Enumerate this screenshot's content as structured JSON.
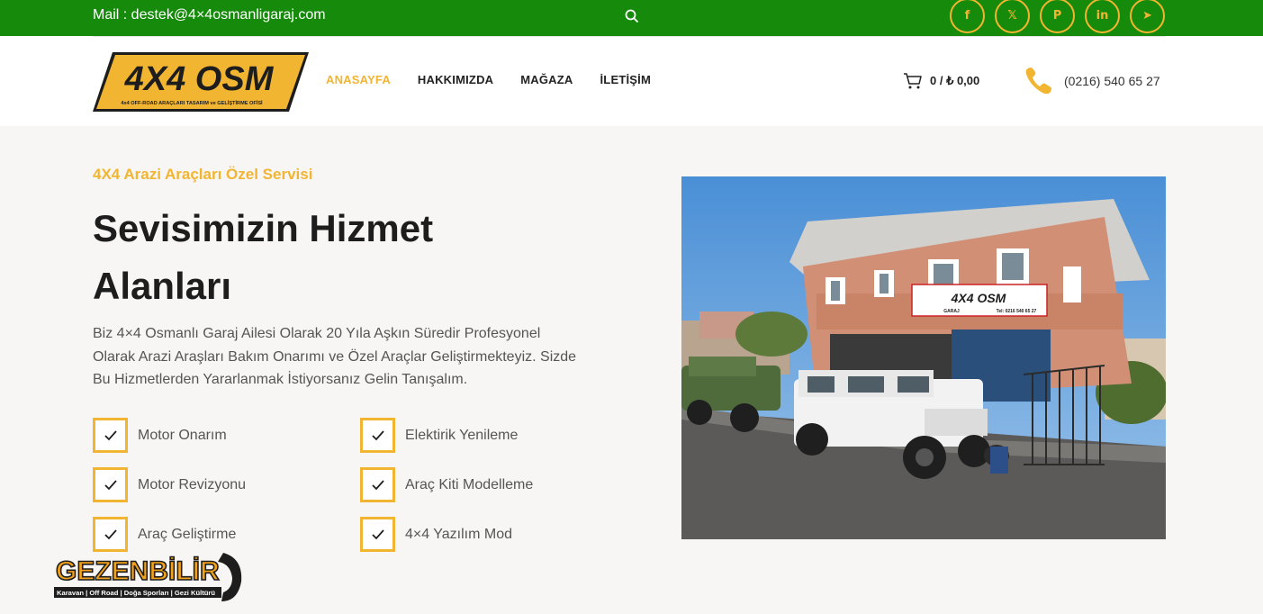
{
  "topbar": {
    "mail": "Mail : destek@4×4osmanligaraj.com",
    "socials": [
      {
        "icon": "facebook-icon",
        "glyph": "f"
      },
      {
        "icon": "x-twitter-icon",
        "glyph": "𝕏"
      },
      {
        "icon": "pinterest-icon",
        "glyph": "P"
      },
      {
        "icon": "linkedin-icon",
        "glyph": "in"
      },
      {
        "icon": "telegram-icon",
        "glyph": "➤"
      }
    ]
  },
  "logo": {
    "main": "4X4 OSM",
    "tagline": "4x4 OFF-ROAD ARAÇLARI TASARIM ve GELİŞTİRME OFİSİ"
  },
  "nav": [
    "ANASAYFA",
    "HAKKIMIZDA",
    "MAĞAZA",
    "İLETİŞİM"
  ],
  "cart": {
    "text": "0 / ₺ 0,00"
  },
  "phone": {
    "text": "(0216) 540 65 27"
  },
  "hero": {
    "subtitle": "4X4 Arazi Araçları Özel Servisi",
    "title_line1": "Sevisimizin Hizmet",
    "title_line2": "Alanları",
    "description": "Biz 4×4 Osmanlı Garaj Ailesi Olarak 20 Yıla Aşkın Süredir Profesyonel Olarak Arazi Araşları Bakım Onarımı ve Özel Araçlar Geliştirmekteyiz. Sizde Bu Hizmetlerden Yararlanmak İstiyorsanız Gelin Tanışalım."
  },
  "features": [
    "Motor Onarım",
    "Elektirik Yenileme",
    "Motor Revizyonu",
    "Araç Kiti Modelleme",
    "Araç Geliştirme",
    "4×4 Yazılım Mod"
  ],
  "photo": {
    "sign_main": "4X4 OSM",
    "sign_sub": "GARAJ",
    "sign_phone": "Tel: 0216 540 65 27"
  },
  "watermark": {
    "brand": "GEZENBİLİR",
    "tagline": "Karavan | Off Road | Doğa Sporları | Gezi Kültürü"
  },
  "colors": {
    "topbar": "#168a0b",
    "accent": "#f2b531",
    "text_dark": "#1d1d1d",
    "background": "#f8f6f4"
  }
}
